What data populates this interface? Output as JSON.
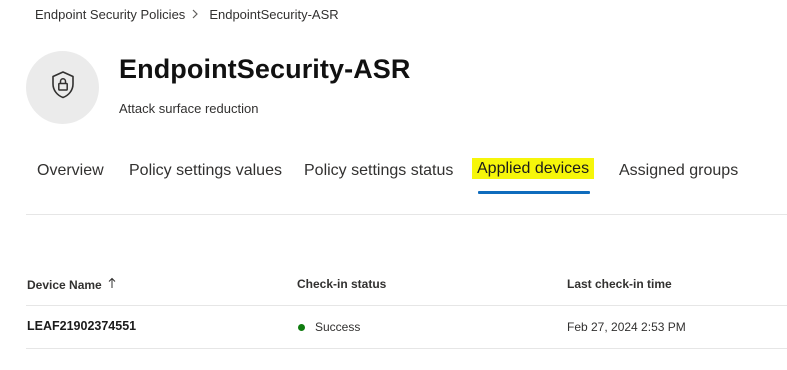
{
  "breadcrumb": {
    "parent": "Endpoint Security Policies",
    "current": "EndpointSecurity-ASR"
  },
  "header": {
    "icon": "shield-lock-icon",
    "title": "EndpointSecurity-ASR",
    "subtitle": "Attack surface reduction"
  },
  "tabs": [
    {
      "label": "Overview",
      "active": false
    },
    {
      "label": "Policy settings values",
      "active": false
    },
    {
      "label": "Policy settings status",
      "active": false
    },
    {
      "label": "Applied devices",
      "active": true
    },
    {
      "label": "Assigned groups",
      "active": false
    }
  ],
  "table": {
    "columns": [
      "Device Name",
      "Check-in status",
      "Last check-in time"
    ],
    "sort_icon": "arrow-up-icon",
    "rows": [
      {
        "device_name": "LEAF21902374551",
        "status": "Success",
        "last_checkin": "Feb 27, 2024 2:53 PM"
      }
    ]
  },
  "colors": {
    "accent": "#0f6cbd",
    "highlight": "#f6f60a",
    "success": "#107c10"
  }
}
